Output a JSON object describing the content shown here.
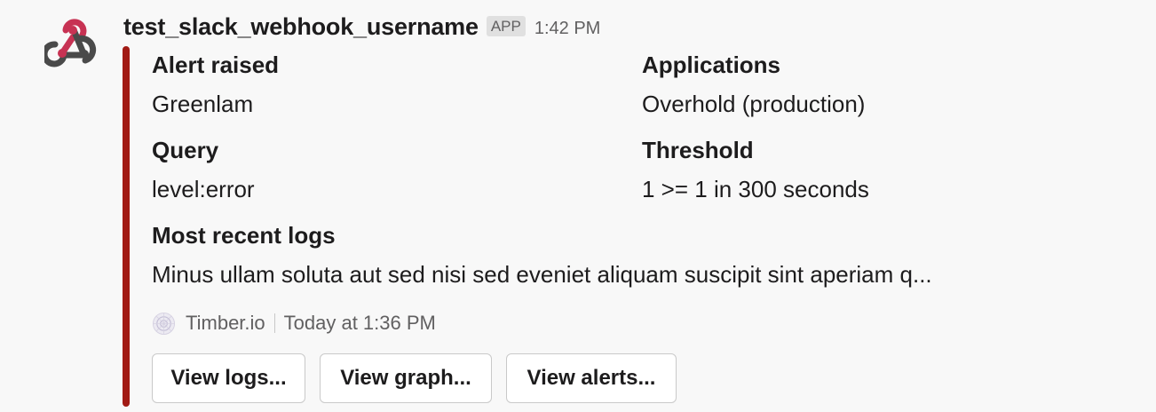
{
  "message": {
    "username": "test_slack_webhook_username",
    "app_badge": "APP",
    "timestamp": "1:42 PM",
    "avatar_icon": "webhook-icon",
    "colors": {
      "attachment_bar": "#a11a14",
      "avatar_red": "#c73253",
      "avatar_dark": "#4a4a4a"
    }
  },
  "attachment": {
    "fields": [
      {
        "title": "Alert raised",
        "value": "Greenlam"
      },
      {
        "title": "Applications",
        "value": "Overhold (production)"
      },
      {
        "title": "Query",
        "value": "level:error"
      },
      {
        "title": "Threshold",
        "value": "1 >= 1 in 300 seconds"
      },
      {
        "title": "Most recent logs",
        "value": "Minus ullam soluta aut sed nisi sed eveniet aliquam suscipit sint aperiam q..."
      }
    ],
    "footer": {
      "icon": "timber-logo-icon",
      "source": "Timber.io",
      "time": "Today at 1:36 PM"
    },
    "actions": [
      {
        "label": "View logs..."
      },
      {
        "label": "View graph..."
      },
      {
        "label": "View alerts..."
      }
    ]
  }
}
